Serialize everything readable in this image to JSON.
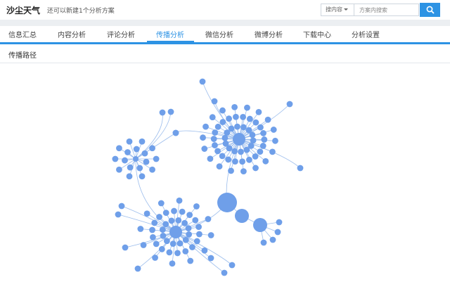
{
  "header": {
    "brand": "沙尘天气",
    "tagline": "还可以新建1个分析方案",
    "search_type_label": "搜内容",
    "search_placeholder": "方案内搜索",
    "search_value": ""
  },
  "nav": {
    "tabs": [
      {
        "label": "信息汇总",
        "active": false
      },
      {
        "label": "内容分析",
        "active": false
      },
      {
        "label": "评论分析",
        "active": false
      },
      {
        "label": "传播分析",
        "active": true
      },
      {
        "label": "微信分析",
        "active": false
      },
      {
        "label": "微博分析",
        "active": false
      },
      {
        "label": "下载中心",
        "active": false
      },
      {
        "label": "分析设置",
        "active": false
      }
    ]
  },
  "section": {
    "title": "传播路径"
  },
  "colors": {
    "accent": "#2d93e4",
    "node": "#6f9fe9",
    "edge": "#9cbdec"
  },
  "icons": {
    "search": "search-icon",
    "caret": "chevron-down-icon"
  }
}
